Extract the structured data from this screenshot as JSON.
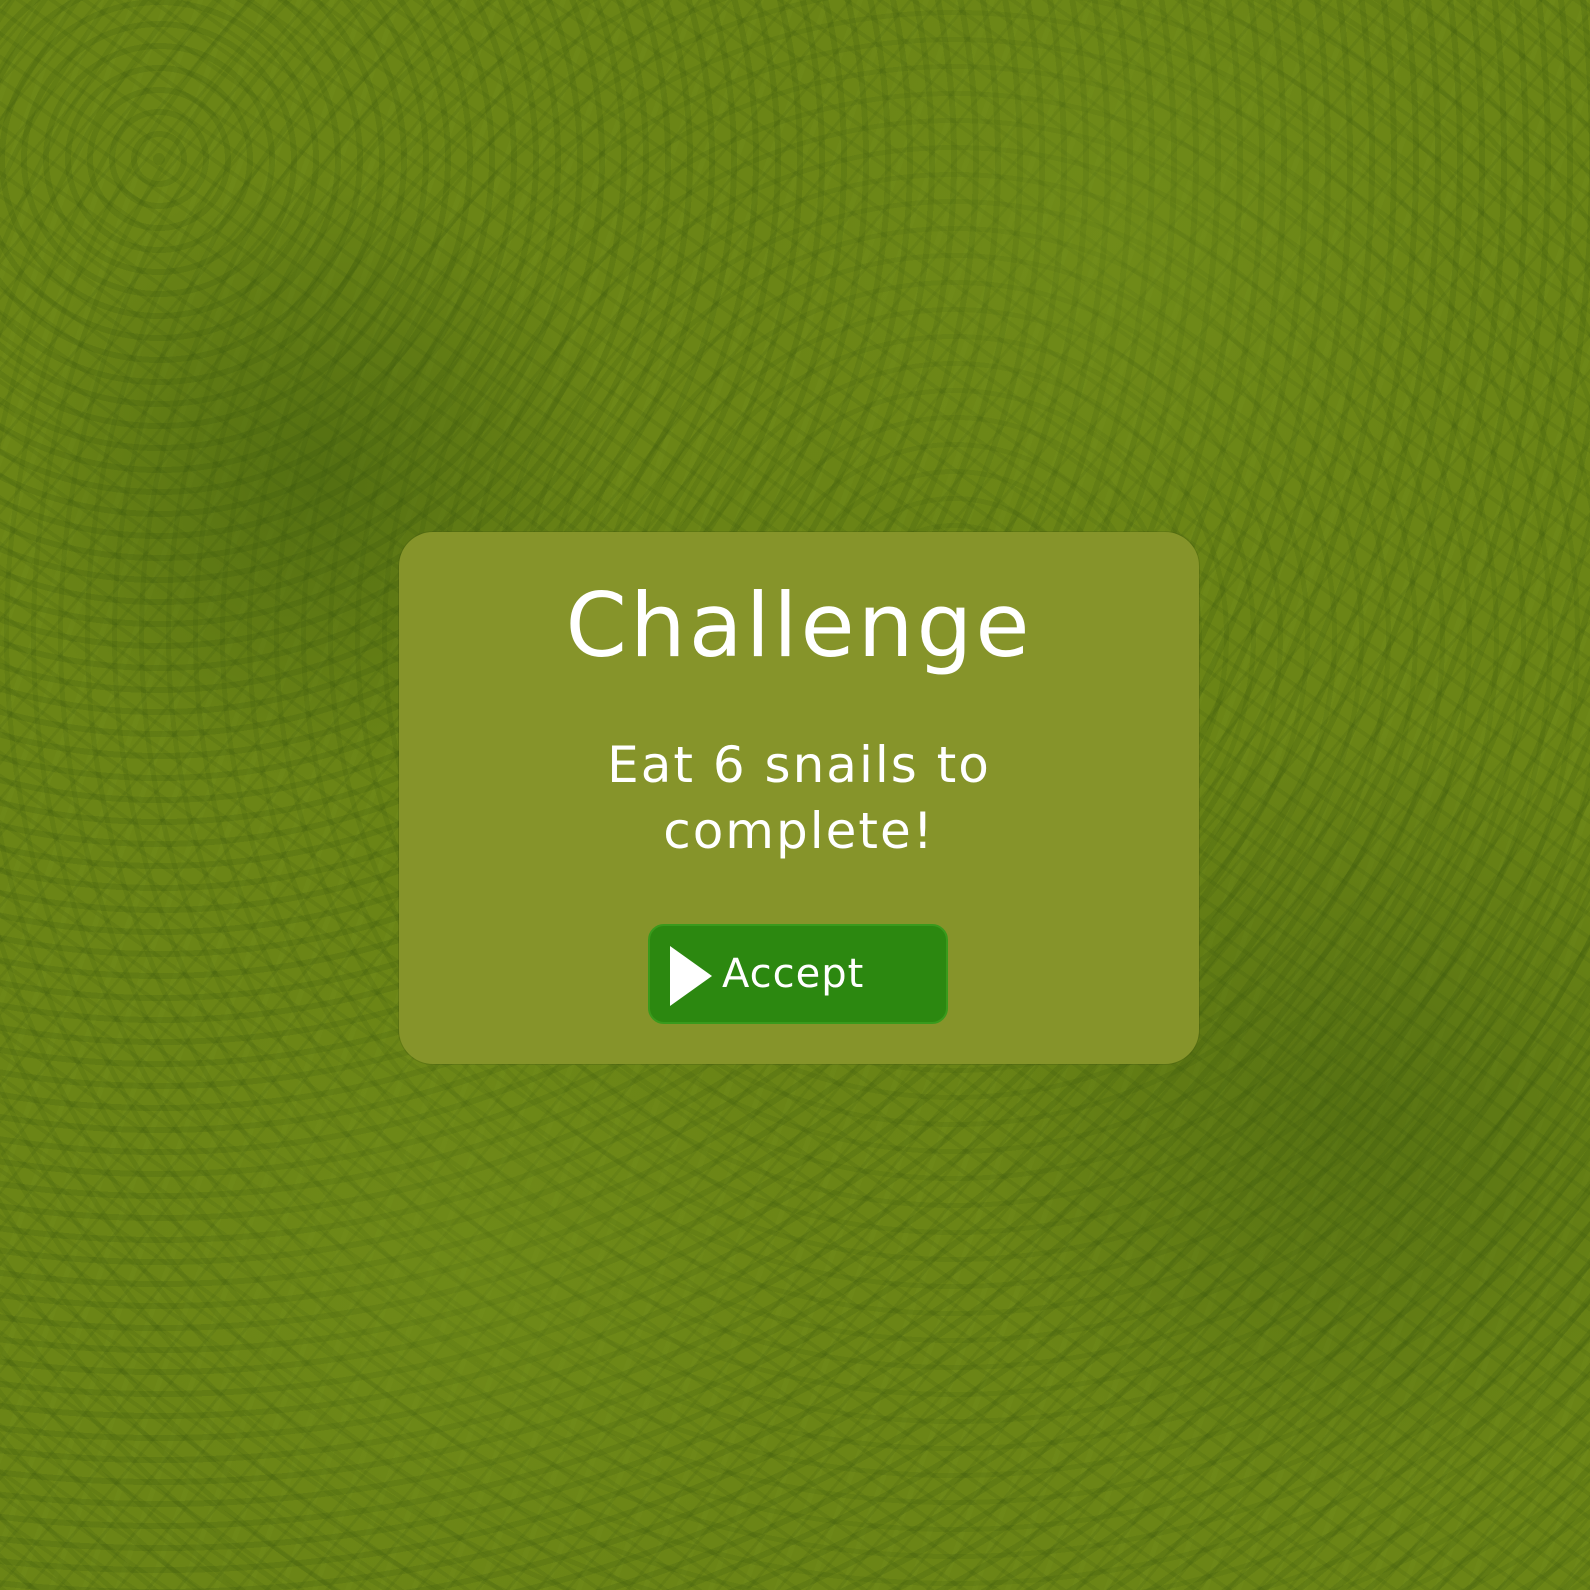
{
  "background": {
    "texture_icon": "grass-texture",
    "base_color": "#6b8516"
  },
  "dialog": {
    "title": "Challenge",
    "message": "Eat 6 snails to complete!",
    "panel_color": "#86942a",
    "accept_button": {
      "label": "Accept",
      "icon": "play-icon",
      "color": "#2c8810"
    }
  }
}
